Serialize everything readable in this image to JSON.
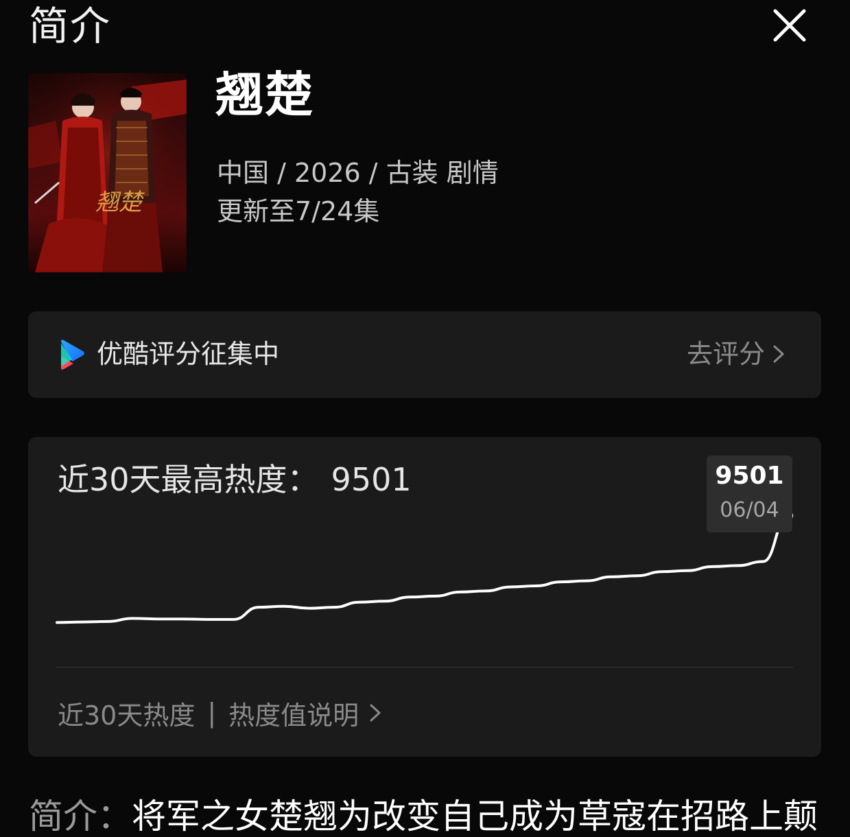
{
  "header": {
    "title": "简介",
    "close_icon": "close-icon"
  },
  "show": {
    "title": "翘楚",
    "meta": "中国 / 2026 / 古装 剧情",
    "update": "更新至7/24集",
    "poster_text": "翘楚"
  },
  "rating": {
    "label": "优酷评分征集中",
    "link_label": "去评分",
    "icon": "youku-logo-icon"
  },
  "heat": {
    "title_prefix": "近30天最高热度：",
    "max_value": "9501",
    "tooltip_value": "9501",
    "tooltip_date": "06/04",
    "footer_left": "近30天热度",
    "footer_sep": "|",
    "footer_link": "热度值说明"
  },
  "synopsis": {
    "label": "简介：",
    "text": "将军之女楚翘为改变自己成为草寇在招路上颠"
  },
  "colors": {
    "background": "#080808",
    "card": "#1b1b1b",
    "tooltip": "#2e2e2e",
    "line": "#ffffff",
    "muted_text": "#8a8a8a"
  },
  "chart_data": {
    "type": "line",
    "title": "",
    "xlabel": "",
    "ylabel": "",
    "grid": false,
    "legend": "none",
    "series": [
      {
        "values": [
          7400,
          7410,
          7420,
          7480,
          7470,
          7470,
          7460,
          7460,
          7700,
          7720,
          7680,
          7700,
          7800,
          7820,
          7900,
          7920,
          8000,
          8020,
          8100,
          8120,
          8200,
          8220,
          8300,
          8320,
          8400,
          8420,
          8500,
          8520,
          8600,
          9501
        ]
      }
    ],
    "ylim": [
      7000,
      9700
    ],
    "highlight": {
      "index": 29,
      "value": 9501,
      "date": "06/04"
    }
  }
}
